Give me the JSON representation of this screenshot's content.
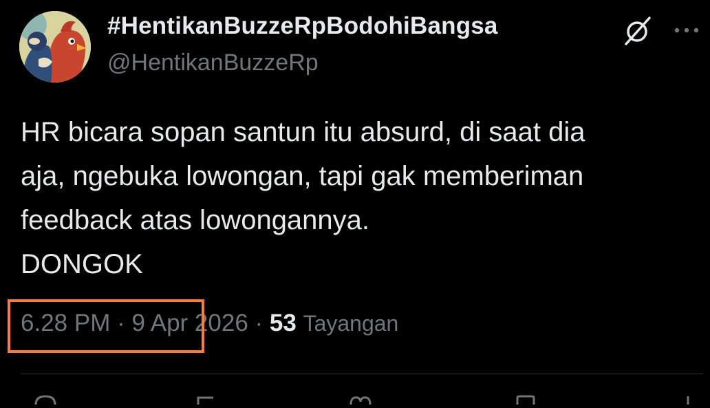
{
  "author": {
    "display_name": "#HentikanBuzzeRpBodohiBangsa",
    "handle": "@HentikanBuzzeRp",
    "avatar_icon": "cartoon-bird-avatar"
  },
  "header_actions": {
    "grok_icon": "grok-icon",
    "more_icon": "more-icon"
  },
  "tweet": {
    "text": "HR bicara sopan santun itu absurd, di saat dia\naja, ngebuka lowongan, tapi gak memberiman\nfeedback atas lowongannya.\nDONGOK"
  },
  "meta": {
    "time": "6.28 PM",
    "separator": " · ",
    "date": "9 Apr 2026",
    "separator2": " · ",
    "views_count": "53",
    "views_label": "Tayangan"
  },
  "colors": {
    "background": "#000000",
    "text_primary": "#e7e9ea",
    "text_secondary": "#71767b",
    "highlight_box": "#ff7a3d"
  },
  "action_bar": {
    "icons": [
      "reply-icon",
      "repost-icon",
      "like-icon",
      "bookmark-icon",
      "share-icon"
    ]
  }
}
